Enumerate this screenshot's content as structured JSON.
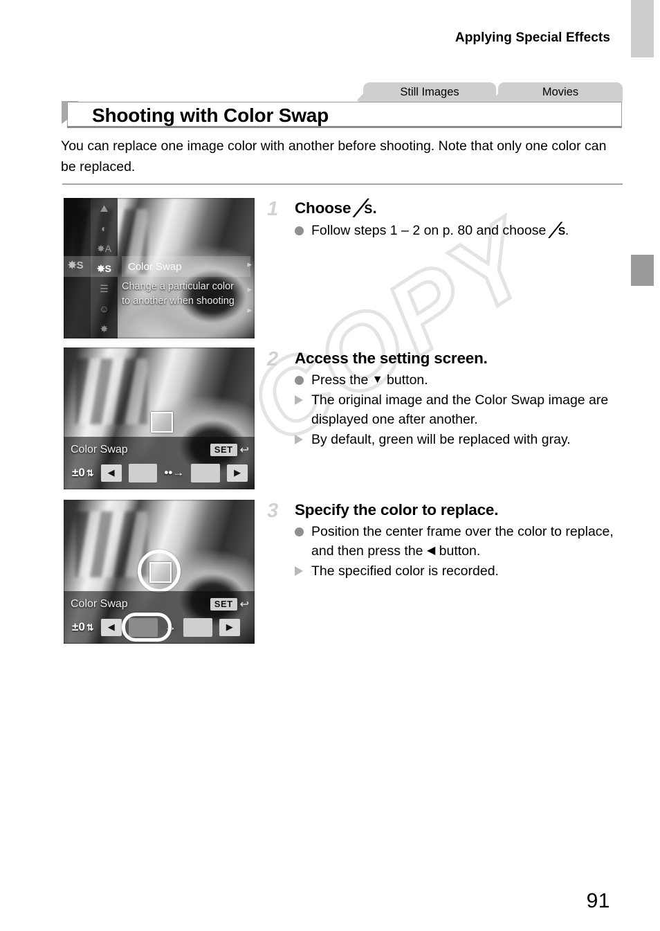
{
  "running_head": "Applying Special Effects",
  "media_tabs": [
    {
      "label": "Still Images"
    },
    {
      "label": "Movies"
    }
  ],
  "section": {
    "title": "Shooting with Color Swap",
    "intro": "You can replace one image color with another before shooting. Note that only one color can be replaced."
  },
  "steps": [
    {
      "number": "1",
      "heading_prefix": "Choose ",
      "heading_icon": "color-swap-icon",
      "heading_icon_glyph": "╱",
      "heading_icon_sub": "S",
      "heading_suffix": ".",
      "lines": [
        {
          "marker": "dot",
          "text_before": "Follow steps 1 – 2 on p. 80 and choose ",
          "icon": "color-swap-icon",
          "icon_glyph": "╱",
          "icon_sub": "S",
          "text_after": "."
        }
      ]
    },
    {
      "number": "2",
      "heading": "Access the setting screen.",
      "lines": [
        {
          "marker": "dot",
          "text_before": "Press the ",
          "icon": "down-button-icon",
          "icon_glyph": "▼",
          "text_after": " button."
        },
        {
          "marker": "triangle",
          "text": "The original image and the Color Swap image are displayed one after another."
        },
        {
          "marker": "triangle",
          "text": "By default, green will be replaced with gray."
        }
      ]
    },
    {
      "number": "3",
      "heading": "Specify the color to replace.",
      "lines": [
        {
          "marker": "dot",
          "text_before": "Position the center frame over the color to replace, and then press the ",
          "icon": "left-button-icon",
          "icon_glyph": "◀",
          "text_after": " button."
        },
        {
          "marker": "triangle",
          "text": "The specified color is recorded."
        }
      ]
    }
  ],
  "screens": {
    "menu": {
      "selected_label": "Color Swap",
      "description_line1": "Change a particular color",
      "description_line2": "to another when shooting",
      "icons": [
        "landscape-icon",
        "fisheye-icon",
        "color-accent-icon",
        "color-swap-icon",
        "monochrome-icon",
        "toy-camera-icon",
        "fireworks-icon"
      ],
      "icon_glyphs": [
        "⛰",
        "◔",
        "╱A",
        "╱S",
        "☰",
        "☺",
        "✸"
      ]
    },
    "setting_bar": {
      "title": "Color Swap",
      "set_key": "SET",
      "return_arrow": "↩",
      "ev_value": "±0",
      "ev_updown": "⇅",
      "left_arrow": "◀",
      "right_arrow": "▶",
      "transition_arrow": "••→",
      "transition_arrow_plain": "→"
    }
  },
  "watermark": {
    "text": "COPY"
  },
  "page_number": "91",
  "colors": {
    "tab_gray": "#cfcfcf",
    "edge_tab_light": "#cccccc",
    "edge_tab_dark": "#999999",
    "rule_gray": "#a6a6a6",
    "step_number_gray": "#d2d2d2",
    "watermark_gray": "#e4e4e4"
  }
}
